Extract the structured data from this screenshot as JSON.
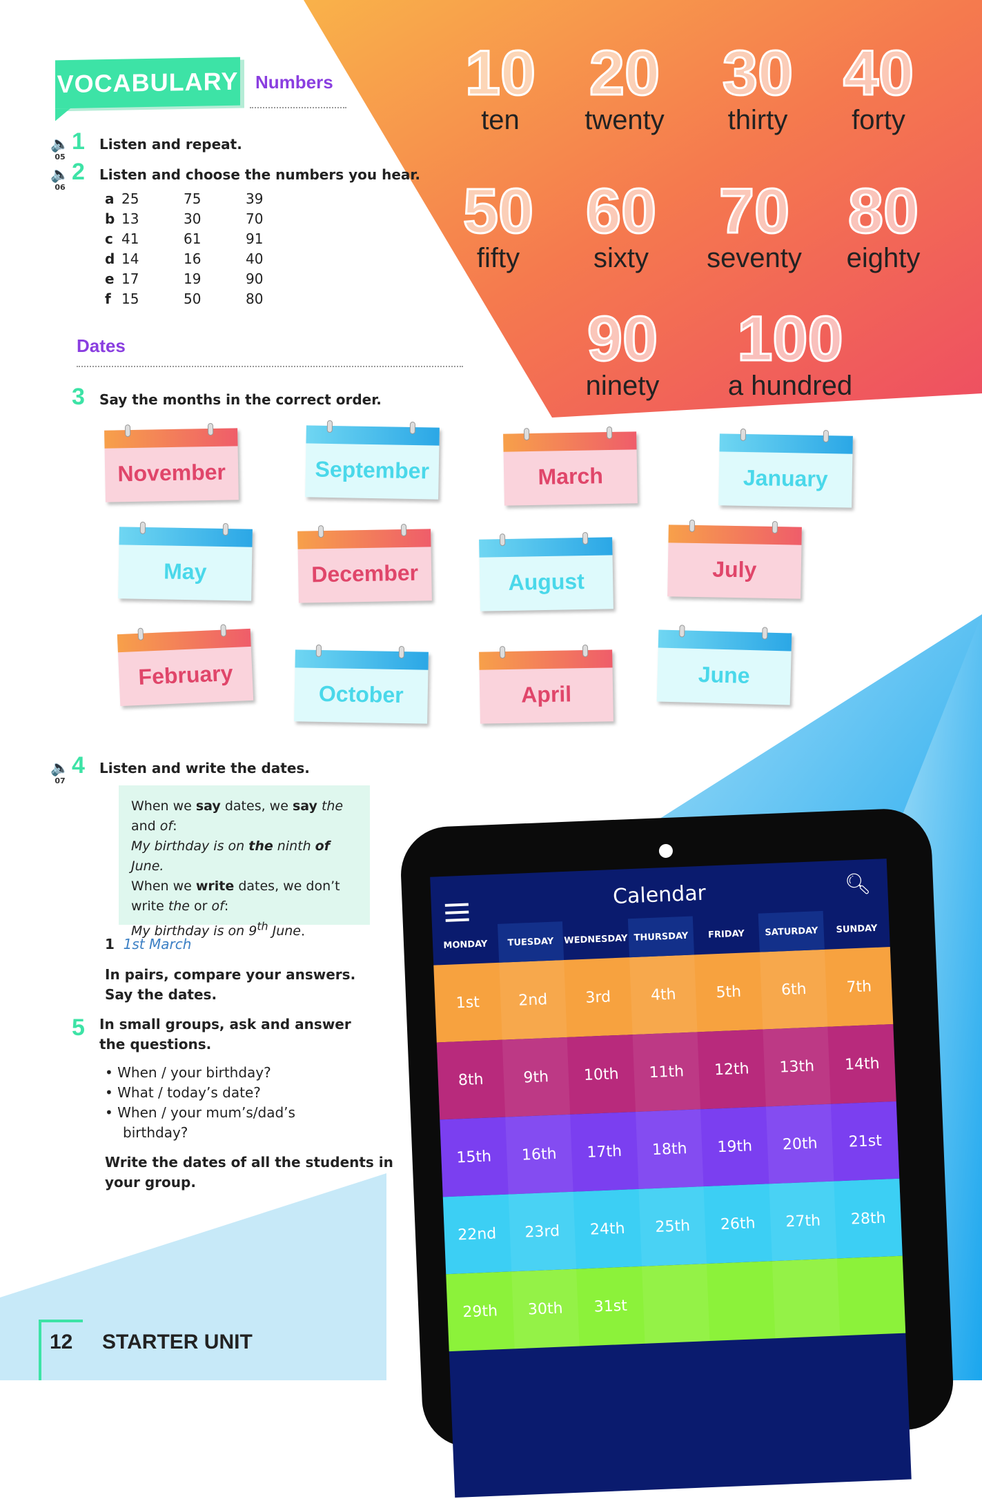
{
  "colors": {
    "accent": "#3de3a6",
    "heading": "#8a3ee0",
    "pink_text": "#e0466a",
    "cyan_text": "#4ad8ea"
  },
  "header": {
    "banner": "VOCABULARY",
    "section1": "Numbers",
    "section2": "Dates"
  },
  "ex1": {
    "num": "1",
    "track": "05",
    "text": "Listen and repeat."
  },
  "ex2": {
    "num": "2",
    "track": "06",
    "text": "Listen and choose the numbers you hear.",
    "rows": [
      {
        "l": "a",
        "v": [
          "25",
          "75",
          "39"
        ]
      },
      {
        "l": "b",
        "v": [
          "13",
          "30",
          "70"
        ]
      },
      {
        "l": "c",
        "v": [
          "41",
          "61",
          "91"
        ]
      },
      {
        "l": "d",
        "v": [
          "14",
          "16",
          "40"
        ]
      },
      {
        "l": "e",
        "v": [
          "17",
          "19",
          "90"
        ]
      },
      {
        "l": "f",
        "v": [
          "15",
          "50",
          "80"
        ]
      }
    ]
  },
  "numbers": [
    {
      "n": "10",
      "w": "ten"
    },
    {
      "n": "20",
      "w": "twenty"
    },
    {
      "n": "30",
      "w": "thirty"
    },
    {
      "n": "40",
      "w": "forty"
    },
    {
      "n": "50",
      "w": "fifty"
    },
    {
      "n": "60",
      "w": "sixty"
    },
    {
      "n": "70",
      "w": "seventy"
    },
    {
      "n": "80",
      "w": "eighty"
    },
    {
      "n": "90",
      "w": "ninety"
    },
    {
      "n": "100",
      "w": "a hundred"
    }
  ],
  "ex3": {
    "num": "3",
    "text": "Say the months in the correct order.",
    "months": [
      {
        "m": "November",
        "c": "pink"
      },
      {
        "m": "September",
        "c": "blue"
      },
      {
        "m": "March",
        "c": "pink"
      },
      {
        "m": "January",
        "c": "blue"
      },
      {
        "m": "May",
        "c": "blue"
      },
      {
        "m": "December",
        "c": "pink"
      },
      {
        "m": "August",
        "c": "blue"
      },
      {
        "m": "July",
        "c": "pink"
      },
      {
        "m": "February",
        "c": "pink"
      },
      {
        "m": "October",
        "c": "blue"
      },
      {
        "m": "April",
        "c": "pink"
      },
      {
        "m": "June",
        "c": "blue"
      }
    ]
  },
  "ex4": {
    "num": "4",
    "track": "07",
    "text": "Listen and write the dates.",
    "tip_html": "When we <b>say</b> dates, we <b>say</b> <i>the</i> and <i>of</i>:<br><i>My birthday is on <b>the</b> ninth <b>of</b> June.</i><br>When we <b>write</b> dates, we don’t write <i>the</i> or <i>of</i>:<br><i>My birthday is on 9<sup>th</sup> June</i>.",
    "example_num": "1",
    "example": "1st March",
    "pairs1": "In pairs, compare your answers.",
    "pairs2": "Say the dates."
  },
  "ex5": {
    "num": "5",
    "text1": "In small groups, ask and answer",
    "text2": "the questions.",
    "bullets": [
      "When / your birthday?",
      "What / today’s date?",
      "When / your mum’s/dad’s",
      "birthday?"
    ],
    "write1": "Write the dates of all the students in",
    "write2": "your group."
  },
  "footer": {
    "page": "12",
    "unit": "STARTER UNIT"
  },
  "calendar": {
    "title": "Calendar",
    "days": [
      "MONDAY",
      "TUESDAY",
      "WEDNESDAY",
      "THURSDAY",
      "FRIDAY",
      "SATURDAY",
      "SUNDAY"
    ],
    "row_colors": [
      "#f7a23f",
      "#b82a7c",
      "#7b3ff0",
      "#3ccff4",
      "#8cf23a"
    ],
    "weeks": [
      [
        "1st",
        "2nd",
        "3rd",
        "4th",
        "5th",
        "6th",
        "7th"
      ],
      [
        "8th",
        "9th",
        "10th",
        "11th",
        "12th",
        "13th",
        "14th"
      ],
      [
        "15th",
        "16th",
        "17th",
        "18th",
        "19th",
        "20th",
        "21st"
      ],
      [
        "22nd",
        "23rd",
        "24th",
        "25th",
        "26th",
        "27th",
        "28th"
      ],
      [
        "29th",
        "30th",
        "31st",
        "",
        "",
        "",
        ""
      ]
    ]
  }
}
